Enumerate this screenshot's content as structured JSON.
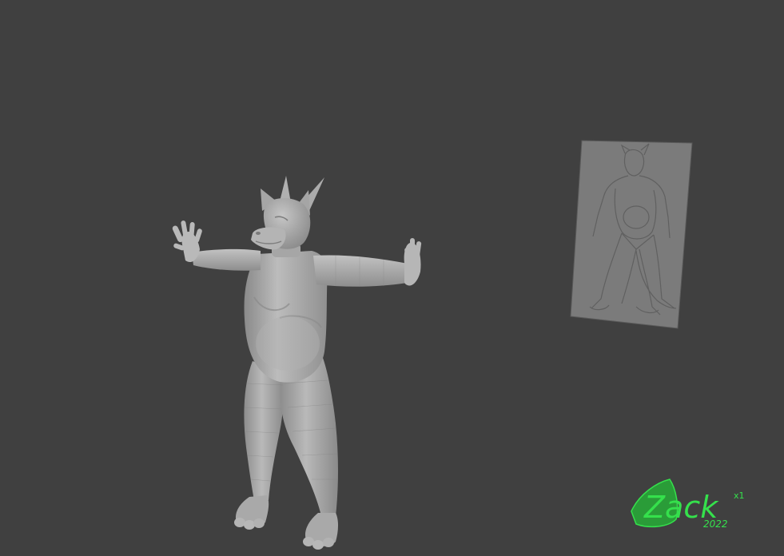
{
  "viewport": {
    "background": "#404040",
    "model_color": "#9c9c9c",
    "reference_color": "#7c7c7c"
  },
  "signature": {
    "text": "Zack",
    "superscript": "x1",
    "year": "2022",
    "color": "#35e04c",
    "leaf_color": "#2a9c38"
  }
}
